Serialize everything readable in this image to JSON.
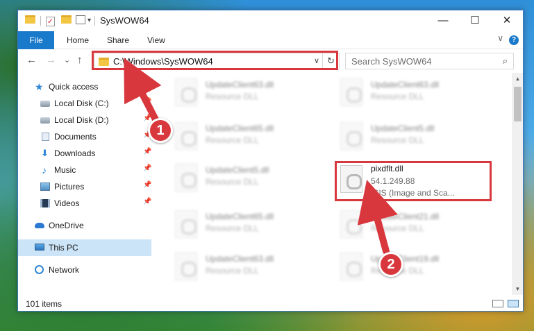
{
  "window": {
    "title": "SysWOW64",
    "quick_access_menu_glyph": "▾",
    "minimize": "—",
    "maximize": "☐",
    "close": "✕"
  },
  "ribbon": {
    "file_tab": "File",
    "tabs": [
      "Home",
      "Share",
      "View"
    ],
    "collapse_glyph": "∨",
    "help_glyph": "?"
  },
  "nav": {
    "back": "←",
    "forward": "→",
    "recent": "⌄",
    "up": "↑",
    "address": "C:\\Windows\\SysWOW64",
    "address_dropdown": "∨",
    "refresh": "↻",
    "search_placeholder": "Search SysWOW64",
    "search_icon": "⌕"
  },
  "sidebar": {
    "items": [
      {
        "label": "Quick access",
        "icon": "star-icon"
      },
      {
        "label": "Local Disk (C:)",
        "icon": "drive-icon",
        "pinned": true
      },
      {
        "label": "Local Disk (D:)",
        "icon": "drive-icon",
        "pinned": true
      },
      {
        "label": "Documents",
        "icon": "documents-icon",
        "pinned": true
      },
      {
        "label": "Downloads",
        "icon": "download-icon",
        "pinned": true
      },
      {
        "label": "Music",
        "icon": "music-icon",
        "pinned": true
      },
      {
        "label": "Pictures",
        "icon": "pictures-icon",
        "pinned": true
      },
      {
        "label": "Videos",
        "icon": "videos-icon",
        "pinned": true
      },
      {
        "label": "OneDrive",
        "icon": "cloud-icon"
      },
      {
        "label": "This PC",
        "icon": "computer-icon",
        "selected": true
      },
      {
        "label": "Network",
        "icon": "network-icon"
      }
    ],
    "pin_glyph": "📌"
  },
  "files": {
    "blurred": [
      {
        "name": "UpdateClient63.dll",
        "type": "Resource DLL"
      },
      {
        "name": "UpdateClient63.dll",
        "type": "Resource DLL"
      },
      {
        "name": "UpdateClient65.dll",
        "type": "Resource DLL"
      },
      {
        "name": "UpdateClient5.dll",
        "type": "Resource DLL"
      },
      {
        "name": "UpdateClient5.dll",
        "type": "Resource DLL"
      },
      {
        "name": "UpdateClient65.dll",
        "type": "Resource DLL"
      },
      {
        "name": "UpdateClient21.dll",
        "type": "Resource DLL"
      },
      {
        "name": "UpdateClient63.dll",
        "type": "Resource DLL"
      },
      {
        "name": "UpdateClient19.dll",
        "type": "Resource DLL"
      }
    ],
    "highlighted": {
      "name": "pixdflt.dll",
      "version": "54.1.249.88",
      "description": "ISIS (Image and Sca..."
    }
  },
  "status": {
    "item_count": "101 items"
  },
  "annotations": {
    "step1": "1",
    "step2": "2",
    "accent_color": "#d8383d"
  }
}
